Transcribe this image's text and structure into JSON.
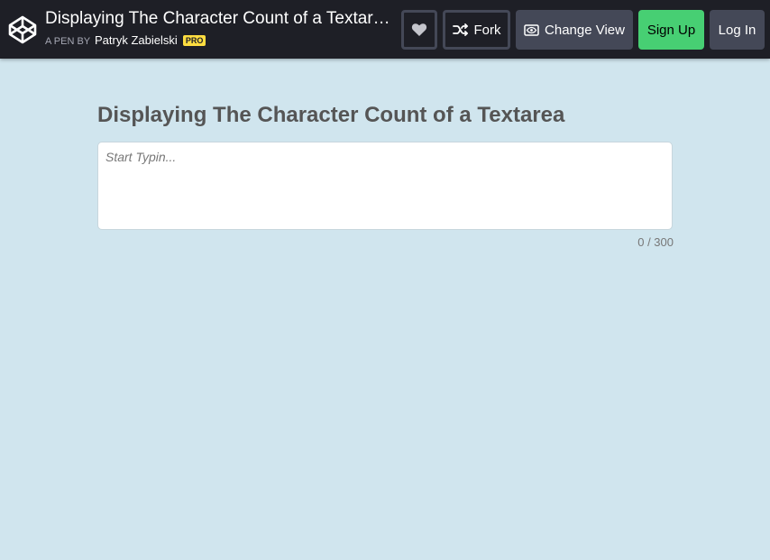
{
  "header": {
    "title": "Displaying The Character Count of a Textarea",
    "byline_prefix": "A PEN BY",
    "author": "Patryk Zabielski",
    "badge": "PRO"
  },
  "actions": {
    "fork_label": "Fork",
    "change_view_label": "Change View",
    "sign_up_label": "Sign Up",
    "log_in_label": "Log In"
  },
  "main": {
    "heading": "Displaying The Character Count of a Textarea",
    "textarea": {
      "placeholder": "Start Typin...",
      "value": ""
    },
    "counter": {
      "current": "0",
      "separator": " / ",
      "max": "300"
    }
  },
  "colors": {
    "background": "#d0e5ee",
    "topbar": "#1e1f26",
    "button_gray": "#444857",
    "sign_up_green": "#47cf73",
    "pro_badge": "#ffdd40"
  },
  "icons": [
    "codepen-logo-icon",
    "heart-icon",
    "fork-icon",
    "eye-icon"
  ]
}
